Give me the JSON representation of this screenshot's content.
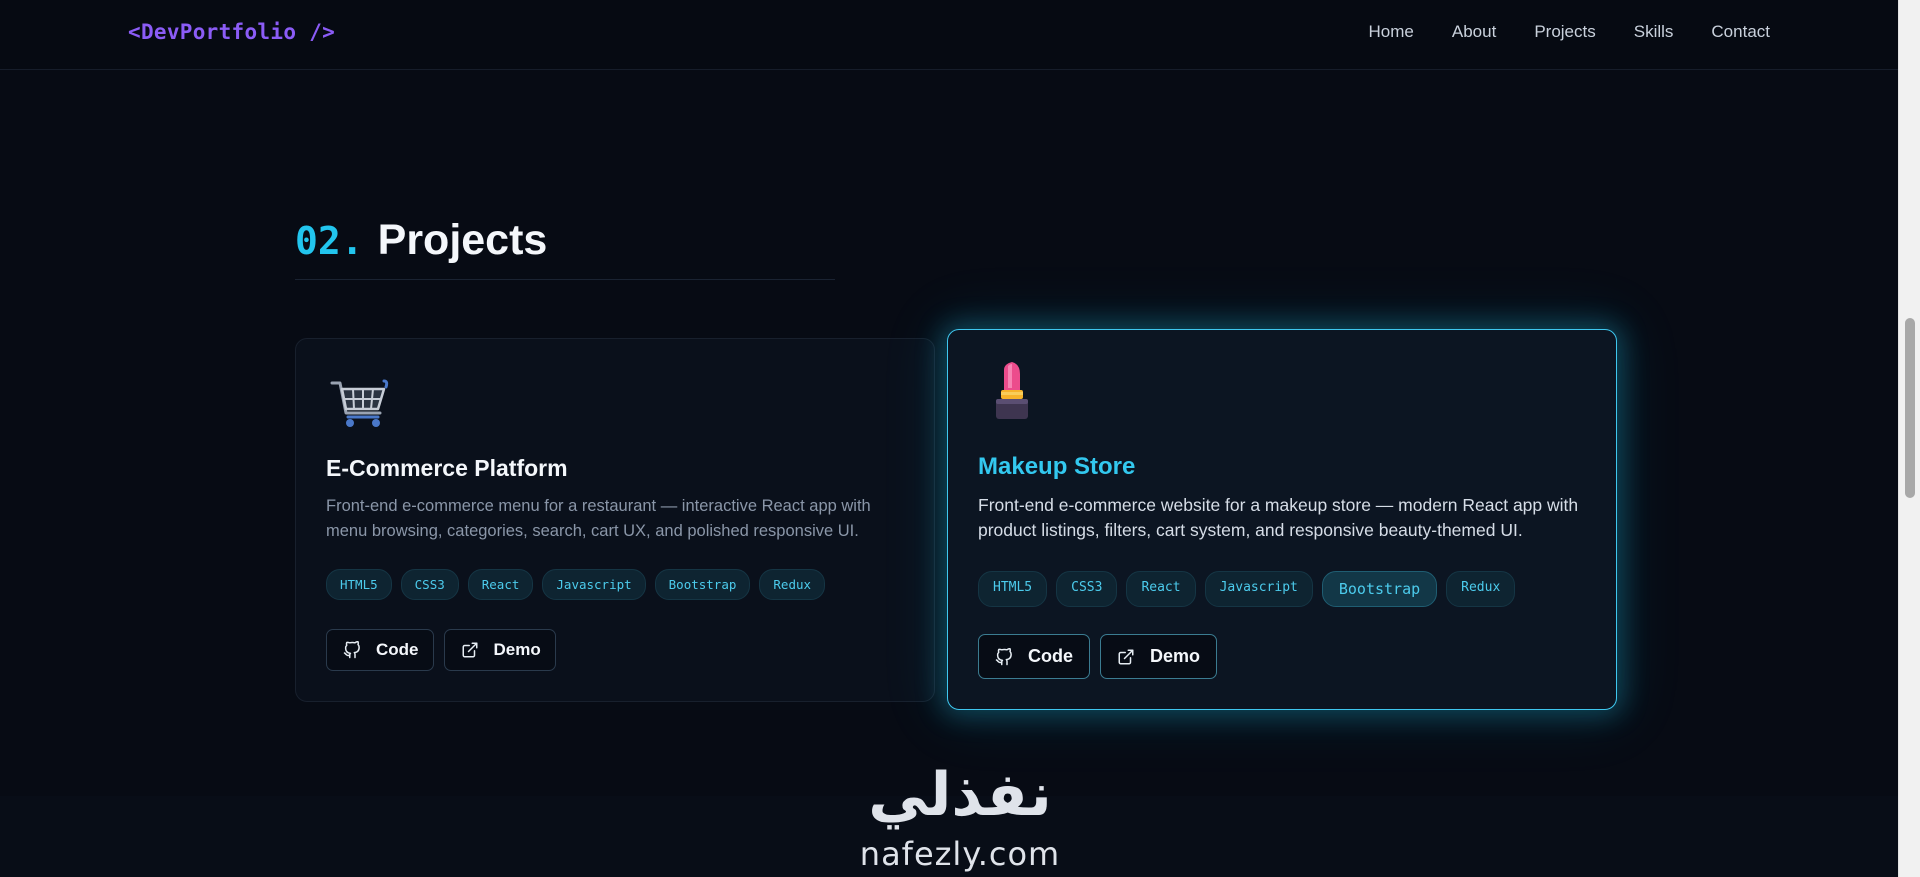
{
  "nav": {
    "logo": "<DevPortfolio />",
    "links": [
      "Home",
      "About",
      "Projects",
      "Skills",
      "Contact"
    ]
  },
  "section": {
    "number": "02.",
    "title": "Projects"
  },
  "projects": [
    {
      "title": "E-Commerce Platform",
      "icon": "shopping-cart-icon",
      "description": "Front-end e-commerce menu for a restaurant — interactive React app with menu browsing, categories, search, cart UX, and polished responsive UI.",
      "tags": [
        "HTML5",
        "CSS3",
        "React",
        "Javascript",
        "Bootstrap",
        "Redux"
      ],
      "code_label": "Code",
      "demo_label": "Demo"
    },
    {
      "title": "Makeup Store",
      "icon": "lipstick-icon",
      "description": "Front-end e-commerce website for a makeup store — modern React app with product listings, filters, cart system, and responsive beauty-themed UI.",
      "tags": [
        "HTML5",
        "CSS3",
        "React",
        "Javascript",
        "Bootstrap",
        "Redux"
      ],
      "code_label": "Code",
      "demo_label": "Demo"
    }
  ],
  "watermark": {
    "arabic": "نفذلي",
    "latin": "nafezly.com"
  },
  "colors": {
    "accent": "#22c5ee",
    "logo": "#8b5cf6",
    "background": "#070b14"
  }
}
